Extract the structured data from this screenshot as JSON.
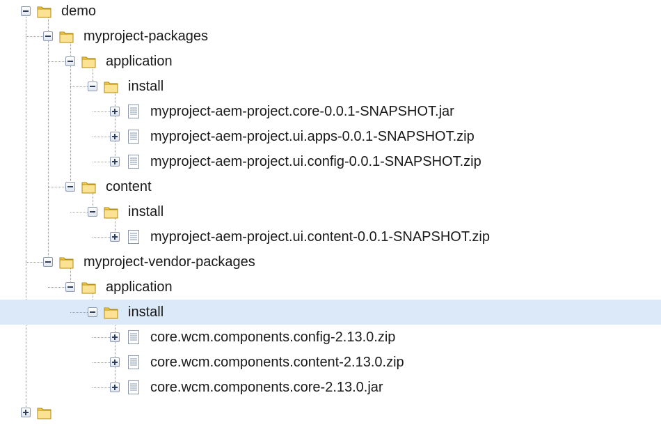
{
  "tree": {
    "nodes": [
      {
        "label": "demo",
        "depth": 0,
        "type": "folder",
        "expanded": true
      },
      {
        "label": "myproject-packages",
        "depth": 1,
        "type": "folder",
        "expanded": true
      },
      {
        "label": "application",
        "depth": 2,
        "type": "folder",
        "expanded": true
      },
      {
        "label": "install",
        "depth": 3,
        "type": "folder",
        "expanded": true
      },
      {
        "label": "myproject-aem-project.core-0.0.1-SNAPSHOT.jar",
        "depth": 4,
        "type": "file",
        "expanded": false
      },
      {
        "label": "myproject-aem-project.ui.apps-0.0.1-SNAPSHOT.zip",
        "depth": 4,
        "type": "file",
        "expanded": false
      },
      {
        "label": "myproject-aem-project.ui.config-0.0.1-SNAPSHOT.zip",
        "depth": 4,
        "type": "file",
        "expanded": false
      },
      {
        "label": "content",
        "depth": 2,
        "type": "folder",
        "expanded": true
      },
      {
        "label": "install",
        "depth": 3,
        "type": "folder",
        "expanded": true
      },
      {
        "label": "myproject-aem-project.ui.content-0.0.1-SNAPSHOT.zip",
        "depth": 4,
        "type": "file",
        "expanded": false
      },
      {
        "label": "myproject-vendor-packages",
        "depth": 1,
        "type": "folder",
        "expanded": true
      },
      {
        "label": "application",
        "depth": 2,
        "type": "folder",
        "expanded": true
      },
      {
        "label": "install",
        "depth": 3,
        "type": "folder",
        "expanded": true,
        "selected": true
      },
      {
        "label": "core.wcm.components.config-2.13.0.zip",
        "depth": 4,
        "type": "file",
        "expanded": false
      },
      {
        "label": "core.wcm.components.content-2.13.0.zip",
        "depth": 4,
        "type": "file",
        "expanded": false
      },
      {
        "label": "core.wcm.components.core-2.13.0.jar",
        "depth": 4,
        "type": "file",
        "expanded": false
      },
      {
        "label": "",
        "depth": 0,
        "type": "folder",
        "expanded": false,
        "partial": true
      }
    ]
  },
  "icons": {
    "folder": "folder-icon",
    "file": "file-icon",
    "collapse": "collapse-toggle-icon",
    "expand": "expand-toggle-icon"
  },
  "colors": {
    "selection": "#dbe9f9",
    "folder_fill": "#f5cf4a",
    "folder_stroke": "#b38a12",
    "file_lines": "#7f93b8",
    "guide_lines": "#9a9a9a"
  }
}
